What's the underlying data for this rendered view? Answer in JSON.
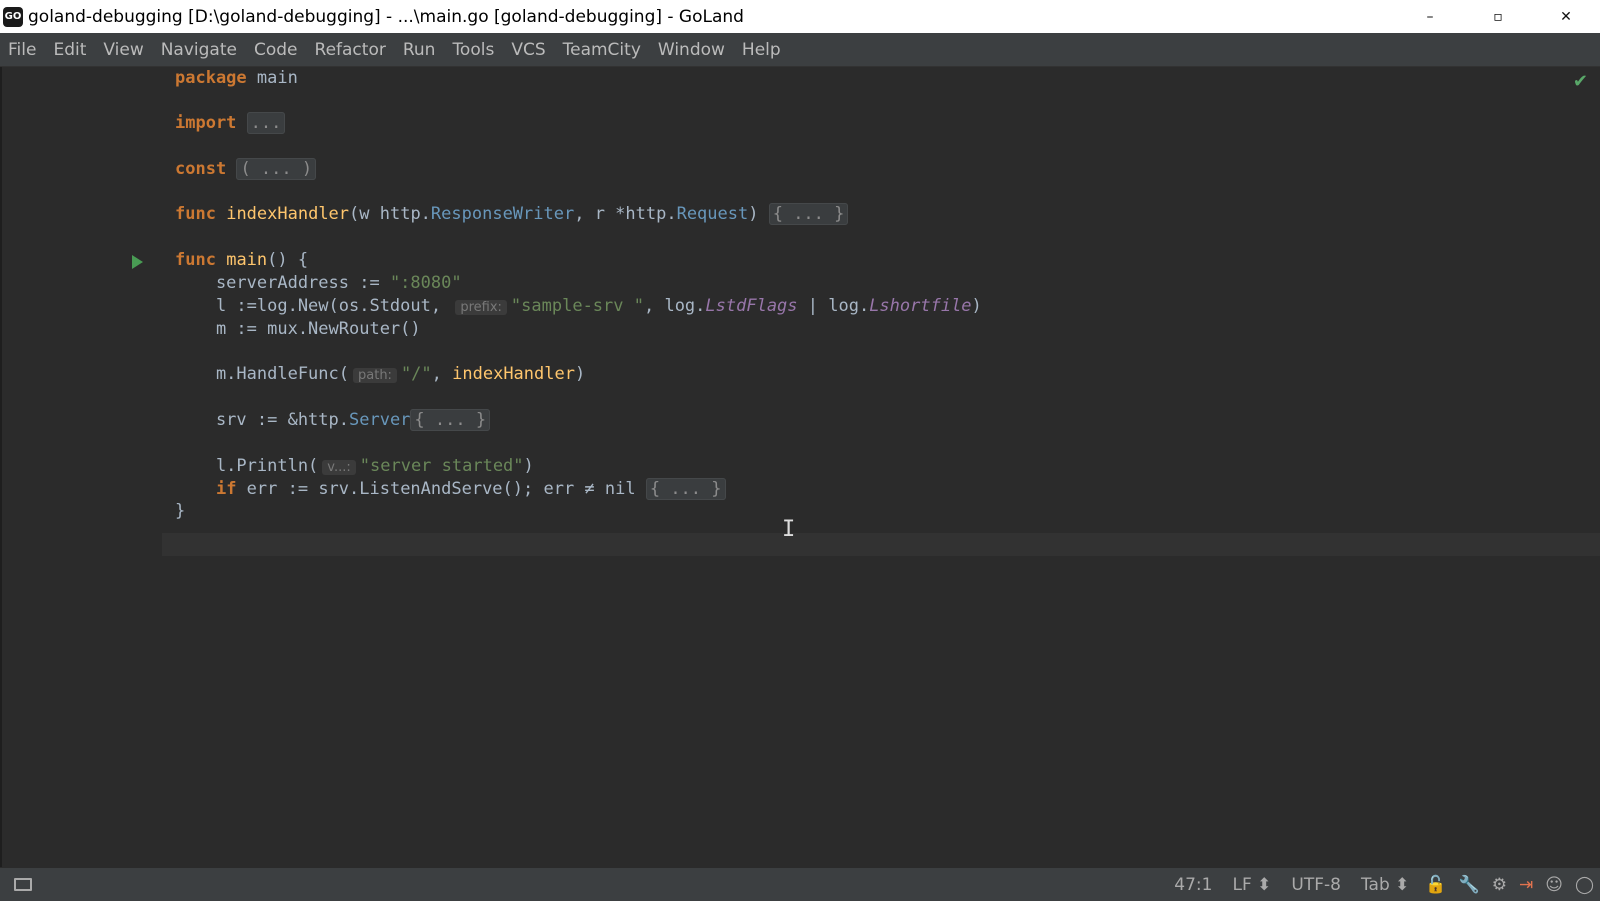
{
  "window": {
    "title": "goland-debugging [D:\\goland-debugging] - ...\\main.go [goland-debugging] - GoLand",
    "logo_text": "GO",
    "minimize": "–",
    "maximize": "▫",
    "close": "✕"
  },
  "menu": [
    {
      "m": "F",
      "rest": "ile"
    },
    {
      "m": "E",
      "rest": "dit"
    },
    {
      "m": "V",
      "rest": "iew"
    },
    {
      "m": "N",
      "rest": "avigate"
    },
    {
      "m": "C",
      "rest": "ode"
    },
    {
      "m": "R",
      "rest": "efactor"
    },
    {
      "m": "R",
      "rest": "un",
      "pre": ""
    },
    {
      "m": "T",
      "rest": "ools"
    },
    {
      "m": "",
      "rest": "VCS"
    },
    {
      "m": "",
      "rest": "TeamCity"
    },
    {
      "m": "W",
      "rest": "indow"
    },
    {
      "m": "H",
      "rest": "elp"
    }
  ],
  "menu_labels": [
    "File",
    "Edit",
    "View",
    "Navigate",
    "Code",
    "Refactor",
    "Run",
    "Tools",
    "VCS",
    "TeamCity",
    "Window",
    "Help"
  ],
  "code": {
    "l1_kw": "package",
    "l1_rest": " main",
    "l2_kw": "import",
    "l2_fold": "...",
    "l3_kw": "const",
    "l3_fold": "( ... )",
    "l4_kw": "func",
    "l4_fn": "indexHandler",
    "l4_p1": "(w http.",
    "l4_t1": "ResponseWriter",
    "l4_p2": ", r *http.",
    "l4_t2": "Request",
    "l4_p3": ") ",
    "l4_fold": "{ ... }",
    "l5_kw": "func",
    "l5_fn": "main",
    "l5_rest": "() {",
    "l6_a": "    serverAddress := ",
    "l6_str": "\":8080\"",
    "l7_a": "    l :=log.New(os.Stdout, ",
    "l7_hint": "prefix:",
    "l7_str": "\"sample-srv \"",
    "l7_b": ", log.",
    "l7_i1": "LstdFlags",
    "l7_c": " | log.",
    "l7_i2": "Lshortfile",
    "l7_d": ")",
    "l8": "    m := mux.NewRouter()",
    "l9_a": "    m.HandleFunc(",
    "l9_hint": "path:",
    "l9_str": "\"/\"",
    "l9_b": ", ",
    "l9_fn": "indexHandler",
    "l9_c": ")",
    "l10_a": "    srv := &http.",
    "l10_t": "Server",
    "l10_fold": "{ ... }",
    "l11_a": "    l.Println(",
    "l11_hint": "v...:",
    "l11_str": "\"server started\"",
    "l11_b": ")",
    "l12_sp": "    ",
    "l12_kw": "if",
    "l12_rest": " err := srv.ListenAndServe(); err ≠ nil ",
    "l12_fold": "{ ... }",
    "l13": "}"
  },
  "status": {
    "position": "47:1",
    "line_sep": "LF ⬍",
    "encoding": "UTF-8",
    "indent": "Tab ⬍"
  },
  "colors": {
    "keyword": "#cc7832",
    "function": "#ffc66d",
    "string": "#6a8759",
    "type": "#6897bb",
    "constant": "#9876aa"
  }
}
